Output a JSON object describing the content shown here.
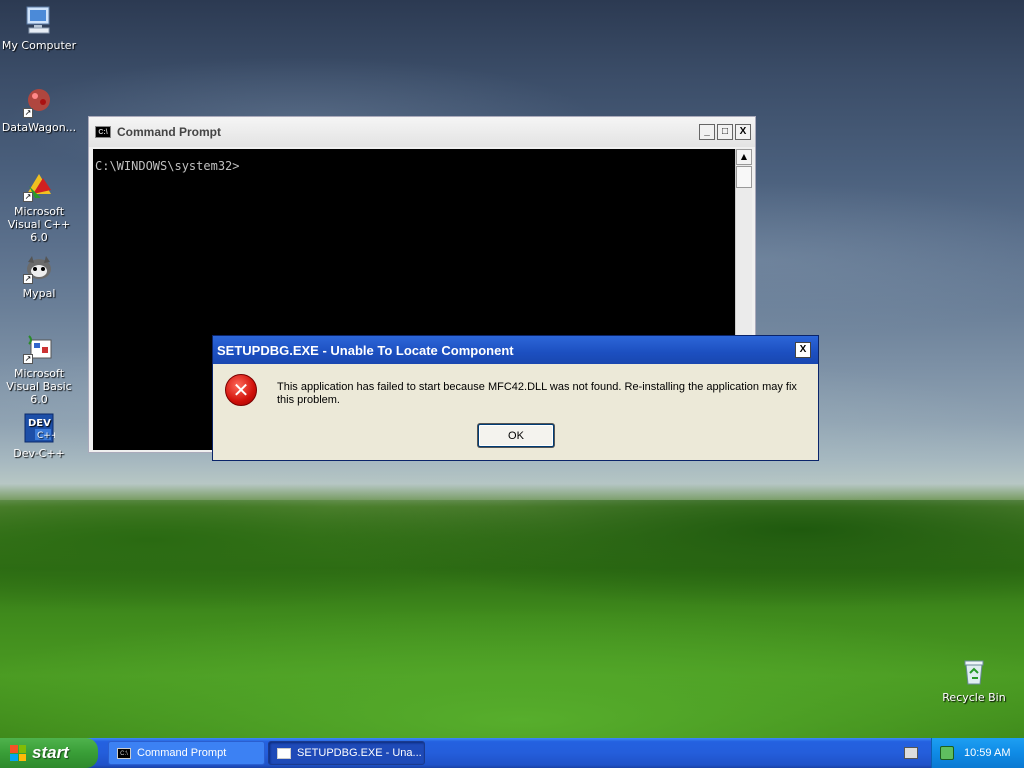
{
  "desktop": {
    "icons": [
      {
        "label": "My Computer",
        "icon": "computer-icon"
      },
      {
        "label": "DataWagon...",
        "icon": "datawagon-icon"
      },
      {
        "label": "Microsoft Visual C++ 6.0",
        "icon": "visual-cpp-icon"
      },
      {
        "label": "Mypal",
        "icon": "mypal-icon"
      },
      {
        "label": "Microsoft Visual Basic 6.0",
        "icon": "visual-basic-icon"
      },
      {
        "label": "Dev-C++",
        "icon": "devcpp-icon"
      },
      {
        "label": "Recycle Bin",
        "icon": "recycle-bin-icon"
      }
    ]
  },
  "cmd_window": {
    "title": "Command Prompt",
    "icon_text": "C:\\",
    "prompt": "C:\\WINDOWS\\system32>",
    "buttons": {
      "minimize": "_",
      "maximize": "□",
      "close": "X"
    }
  },
  "error_dialog": {
    "title": "SETUPDBG.EXE - Unable To Locate Component",
    "close": "X",
    "message": "This application has failed to start because MFC42.DLL was not found. Re-installing the application may fix this problem.",
    "ok_label": "OK",
    "icon_glyph": "✕"
  },
  "taskbar": {
    "start_label": "start",
    "tasks": [
      {
        "label": "Command Prompt",
        "active": false
      },
      {
        "label": "SETUPDBG.EXE - Una...",
        "active": true
      }
    ],
    "clock": "10:59 AM"
  },
  "colors": {
    "title_active": "#245edb",
    "taskbar": "#245edb",
    "start_green": "#399e37",
    "error_red": "#d0100a"
  }
}
